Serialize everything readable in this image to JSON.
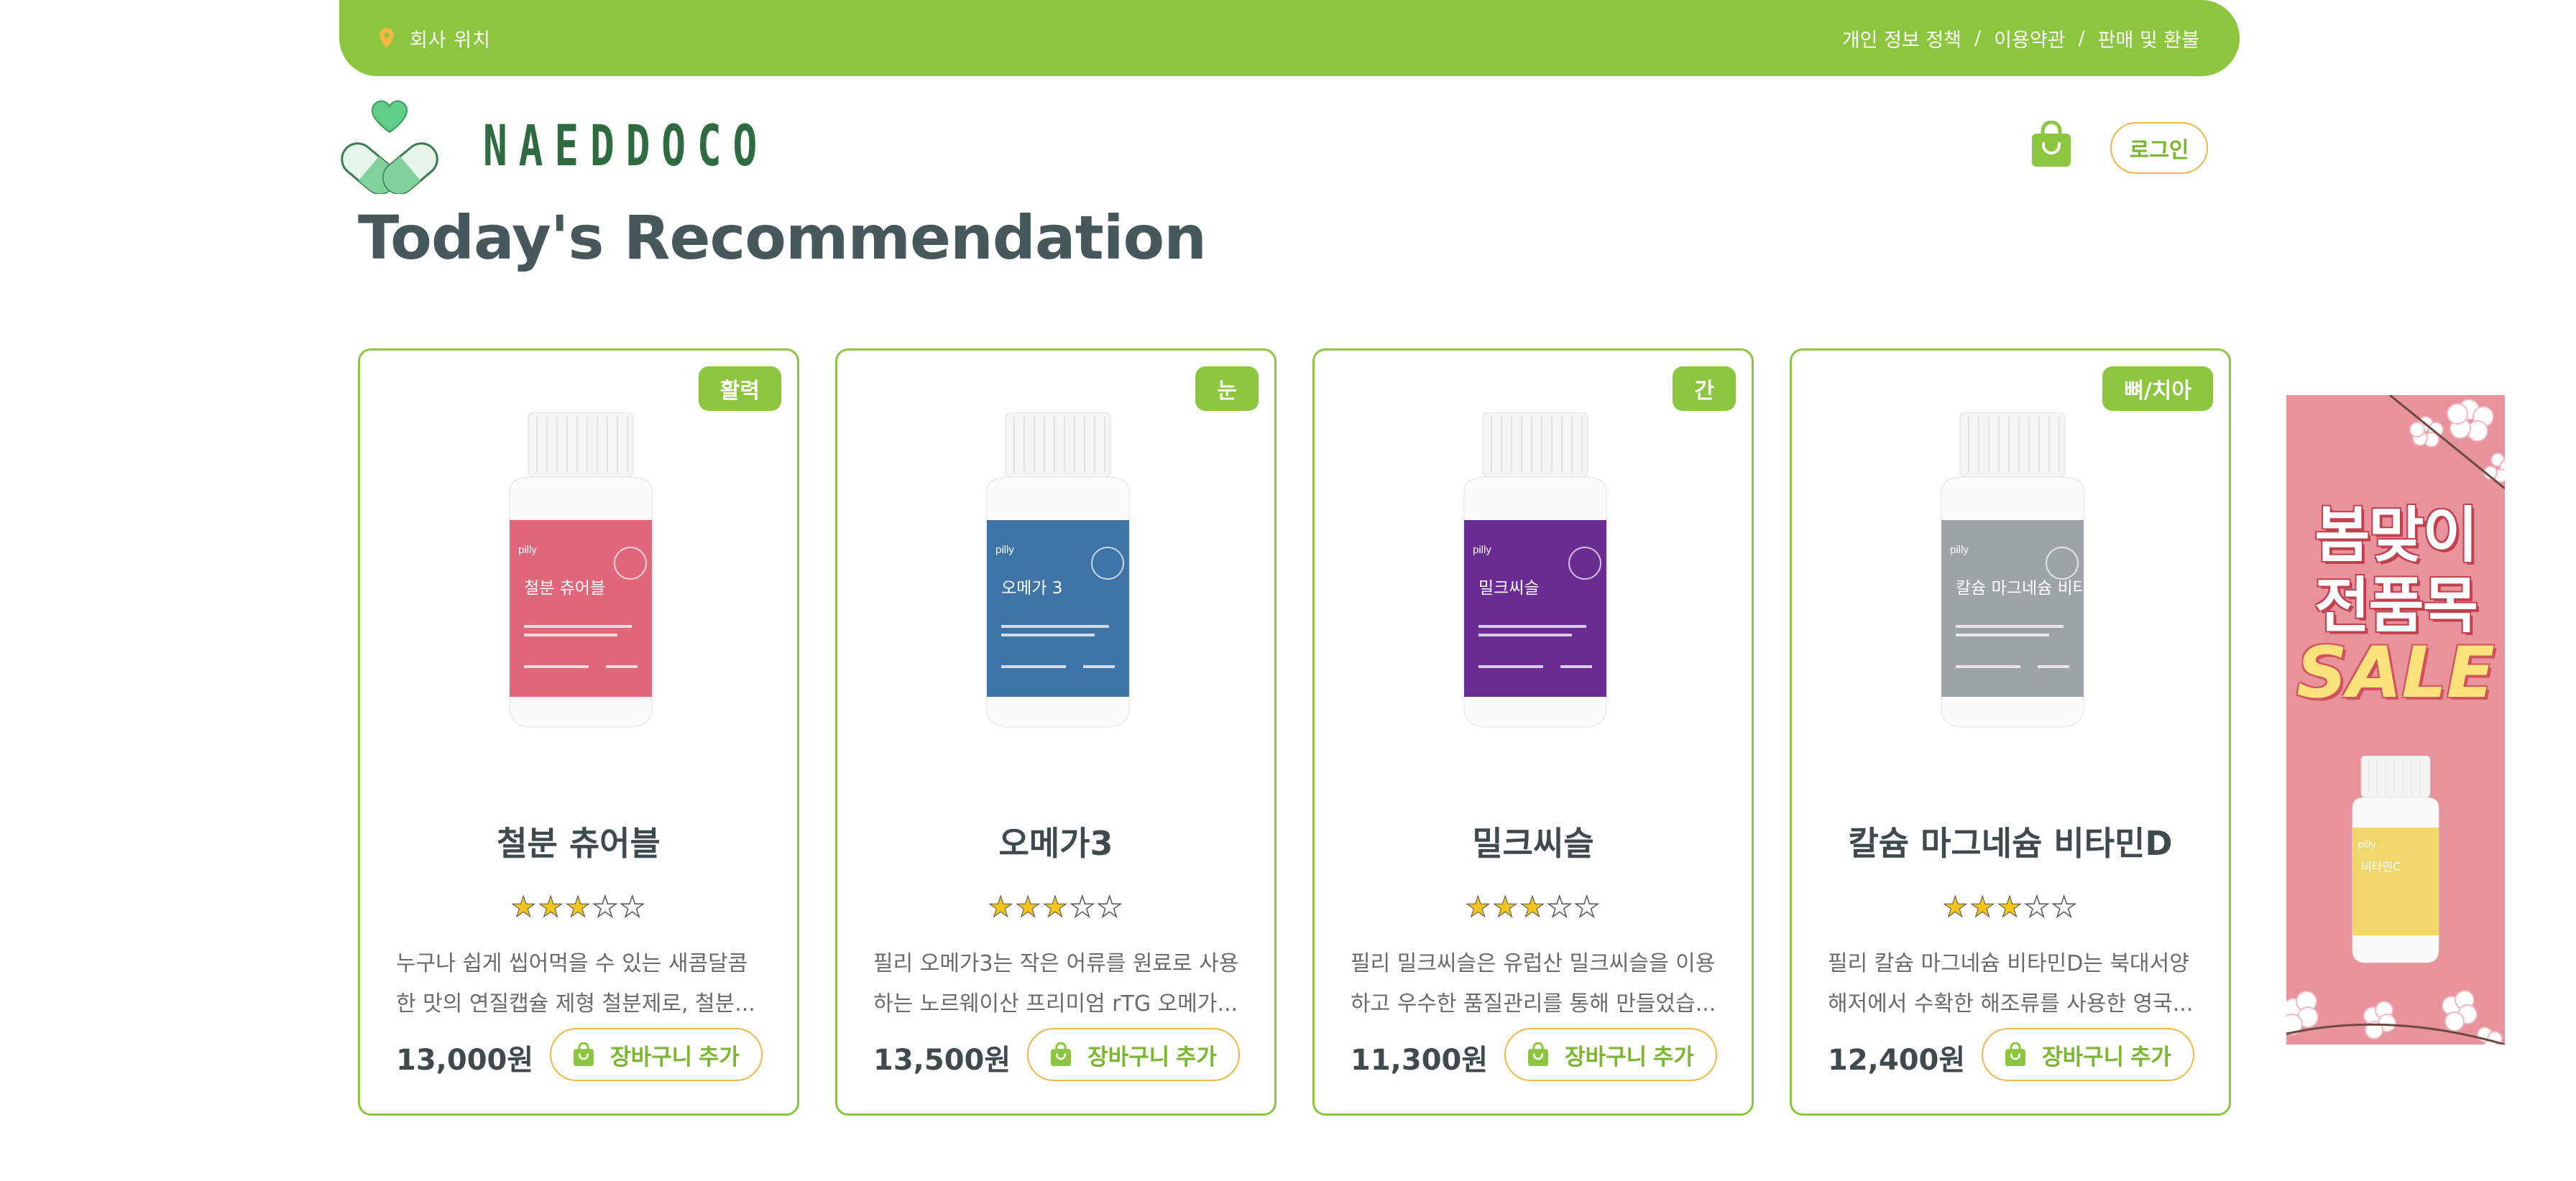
{
  "topbar": {
    "location": "회사 위치",
    "links": [
      "개인 정보 정책",
      "이용약관",
      "판매 및 환불"
    ],
    "separator": "/"
  },
  "header": {
    "logo_text": "NAEDDOCO",
    "login_label": "로그인"
  },
  "page": {
    "title": "Today's Recommendation"
  },
  "products": [
    {
      "tag": "활력",
      "name": "철분 츄어블",
      "rating": 3,
      "max_rating": 5,
      "desc_line1": "누구나 쉽게 씹어먹을 수 있는 새콤달콤",
      "desc_line2": "한 맛의 연질캡슐 제형 철분제로, 철분...",
      "price": "13,000원",
      "cart_label": "장바구니 추가",
      "bottle_color": "#e0677a",
      "bottle_label": "철분 츄어블",
      "bottle_brand": "pilly"
    },
    {
      "tag": "눈",
      "name": "오메가3",
      "rating": 3,
      "max_rating": 5,
      "desc_line1": "필리 오메가3는 작은 어류를 원료로 사용",
      "desc_line2": "하는 노르웨이산 프리미엄 rTG 오메가...",
      "price": "13,500원",
      "cart_label": "장바구니 추가",
      "bottle_color": "#3f74a8",
      "bottle_label": "오메가 3",
      "bottle_brand": "pilly"
    },
    {
      "tag": "간",
      "name": "밀크씨슬",
      "rating": 3,
      "max_rating": 5,
      "desc_line1": "필리 밀크씨슬은 유럽산 밀크씨슬을 이용",
      "desc_line2": "하고 우수한 품질관리를 통해 만들었습...",
      "price": "11,300원",
      "cart_label": "장바구니 추가",
      "bottle_color": "#6a2c93",
      "bottle_label": "밀크씨슬",
      "bottle_brand": "pilly"
    },
    {
      "tag": "뼈/치아",
      "name": "칼슘 마그네슘 비타민D",
      "rating": 3,
      "max_rating": 5,
      "desc_line1": "필리 칼슘 마그네슘 비타민D는 북대서양",
      "desc_line2": "해저에서 수확한 해조류를 사용한 영국...",
      "price": "12,400원",
      "cart_label": "장바구니 추가",
      "bottle_color": "#9da4a8",
      "bottle_label": "칼슘 마그네슘 비타민 D",
      "bottle_brand": "pilly"
    }
  ],
  "sale_banner": {
    "line1": "봄맞이",
    "line2": "전품목",
    "line3": "SALE",
    "bottle_color": "#f1d76a",
    "bottle_brand": "pilly",
    "bottle_label": "비타민C"
  },
  "colors": {
    "accent": "#8cc63f",
    "button_border": "#f0b64a",
    "logo_green": "#2f6b40",
    "sale_bg": "#e8929b"
  },
  "icons": {
    "location": "map-pin-icon",
    "cart": "shopping-bag-icon",
    "star": "star-icon"
  }
}
